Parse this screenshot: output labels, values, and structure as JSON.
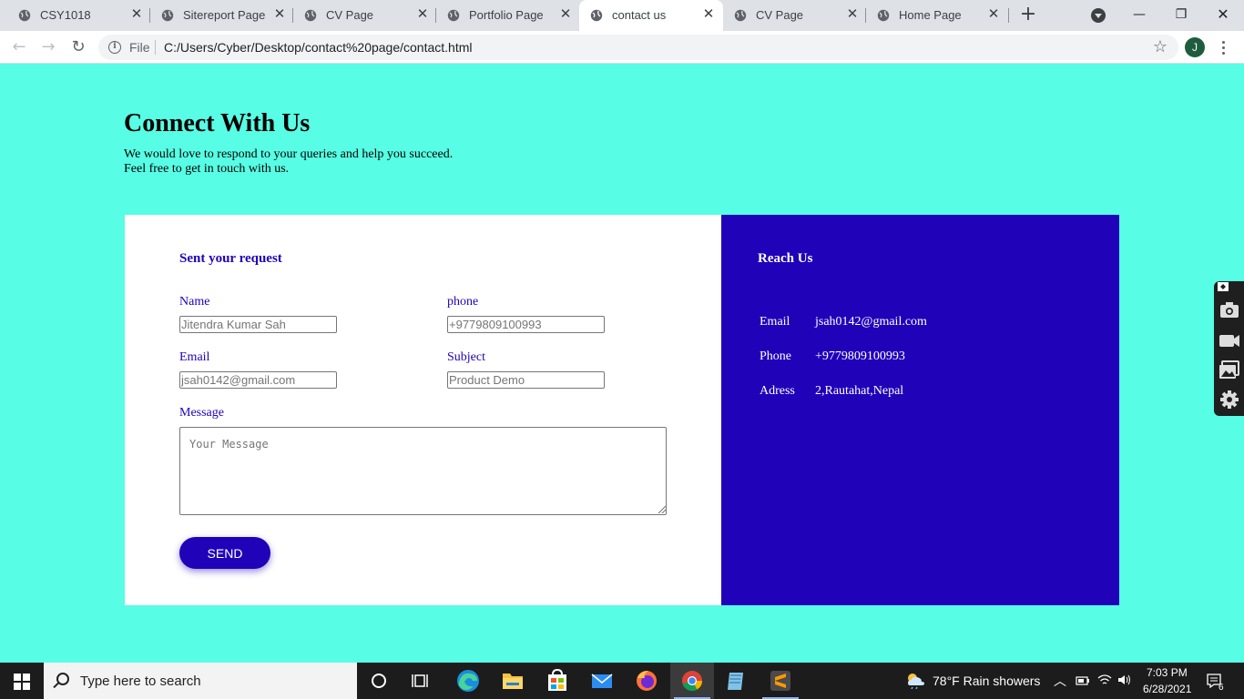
{
  "browser": {
    "tabs": [
      {
        "label": "CSY1018",
        "active": false
      },
      {
        "label": "Sitereport Page",
        "active": false
      },
      {
        "label": "CV Page",
        "active": false
      },
      {
        "label": "Portfolio Page",
        "active": false
      },
      {
        "label": "contact us",
        "active": true
      },
      {
        "label": "CV Page",
        "active": false
      },
      {
        "label": "Home Page",
        "active": false
      }
    ],
    "address": {
      "scheme_label": "File",
      "url": "C:/Users/Cyber/Desktop/contact%20page/contact.html"
    },
    "profile_initial": "J",
    "window_controls": {
      "minimize": "—",
      "restore": "❐",
      "close": "✕"
    }
  },
  "page": {
    "title": "Connect With Us",
    "intro_line1": "We would love to respond to your queries and help you succeed.",
    "intro_line2": "Feel free to get in touch with us.",
    "form": {
      "heading": "Sent your request",
      "name_label": "Name",
      "name_placeholder": "Jitendra Kumar Sah",
      "phone_label": "phone",
      "phone_placeholder": "+9779809100993",
      "email_label": "Email",
      "email_placeholder": "jsah0142@gmail.com",
      "subject_label": "Subject",
      "subject_placeholder": "Product Demo",
      "message_label": "Message",
      "message_placeholder": "Your Message",
      "send_label": "SEND"
    },
    "reach": {
      "heading": "Reach Us",
      "rows": [
        {
          "key": "Email",
          "value": "jsah0142@gmail.com"
        },
        {
          "key": "Phone",
          "value": "+9779809100993"
        },
        {
          "key": "Adress",
          "value": "2,Rautahat,Nepal"
        }
      ]
    },
    "colors": {
      "background": "#57fde4",
      "accent": "#2002b9",
      "card": "#ffffff"
    }
  },
  "taskbar": {
    "search_placeholder": "Type here to search",
    "weather": "78°F  Rain showers",
    "time": "7:03 PM",
    "date": "6/28/2021",
    "notification_count": "6",
    "pinned_apps": [
      "task-view",
      "edge",
      "file-explorer",
      "microsoft-store",
      "mail",
      "firefox",
      "chrome",
      "notepad",
      "sublime-text"
    ]
  }
}
